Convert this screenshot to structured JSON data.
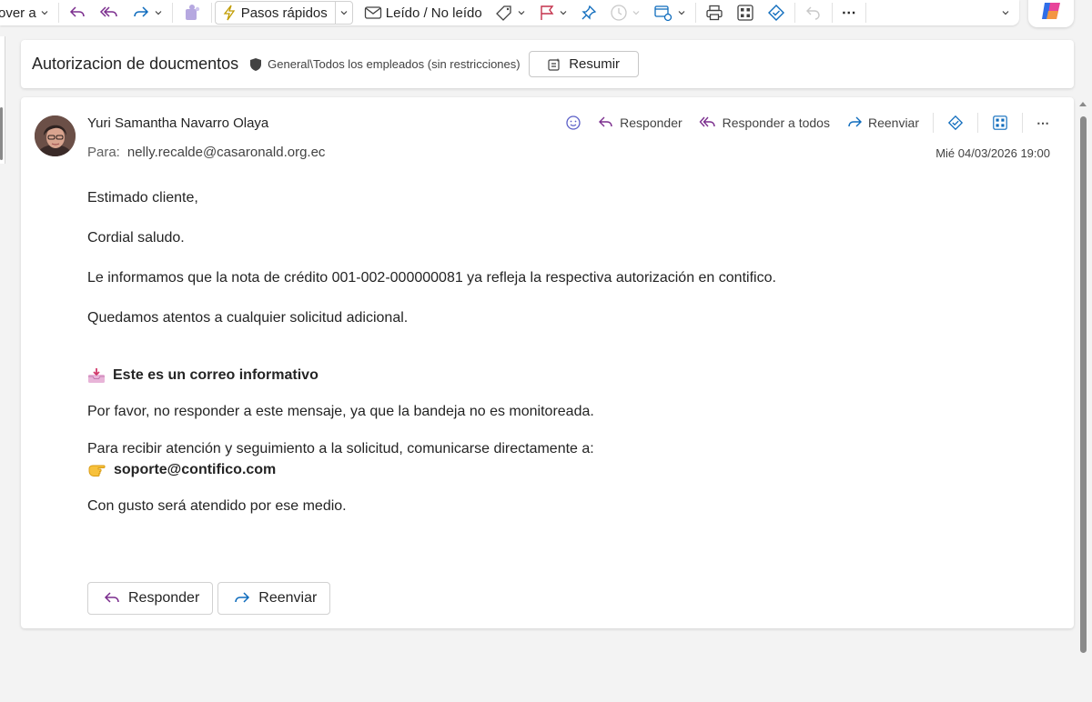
{
  "toolbar": {
    "move_label": "over a",
    "quick_steps_label": "Pasos rápidos",
    "read_unread_label": "Leído / No leído",
    "more_label": "⋯"
  },
  "subject": {
    "title": "Autorizacion de doucmentos",
    "sensitivity": "General\\Todos los empleados (sin restricciones)",
    "summarize_label": "Resumir"
  },
  "message": {
    "sender": "Yuri Samantha Navarro Olaya",
    "to_label": "Para:",
    "to_address": "nelly.recalde@casaronald.org.ec",
    "date": "Mié 04/03/2026 19:00",
    "actions": {
      "reply": "Responder",
      "reply_all": "Responder a todos",
      "forward": "Reenviar",
      "more": "⋯"
    },
    "body": {
      "greeting": "Estimado cliente,",
      "salutation": "Cordial saludo.",
      "line1": "Le informamos que la nota de crédito 001-002-000000081 ya refleja la respectiva autorización en contifico.",
      "line2": "Quedamos atentos a cualquier solicitud adicional.",
      "notice_title": "Este es un correo informativo",
      "notice_line": "Por favor, no responder a este mensaje, ya que la bandeja no es monitoreada.",
      "contact_line": "Para recibir atención y seguimiento a la solicitud, comunicarse directamente a:",
      "contact_email": "soporte@contifico.com",
      "closing": "Con gusto será atendido por ese medio."
    },
    "bottom_reply": "Responder",
    "bottom_forward": "Reenviar"
  },
  "icons": {
    "inbox_tray": "inbox-tray-icon",
    "pointing_hand": "pointing-hand-icon"
  }
}
